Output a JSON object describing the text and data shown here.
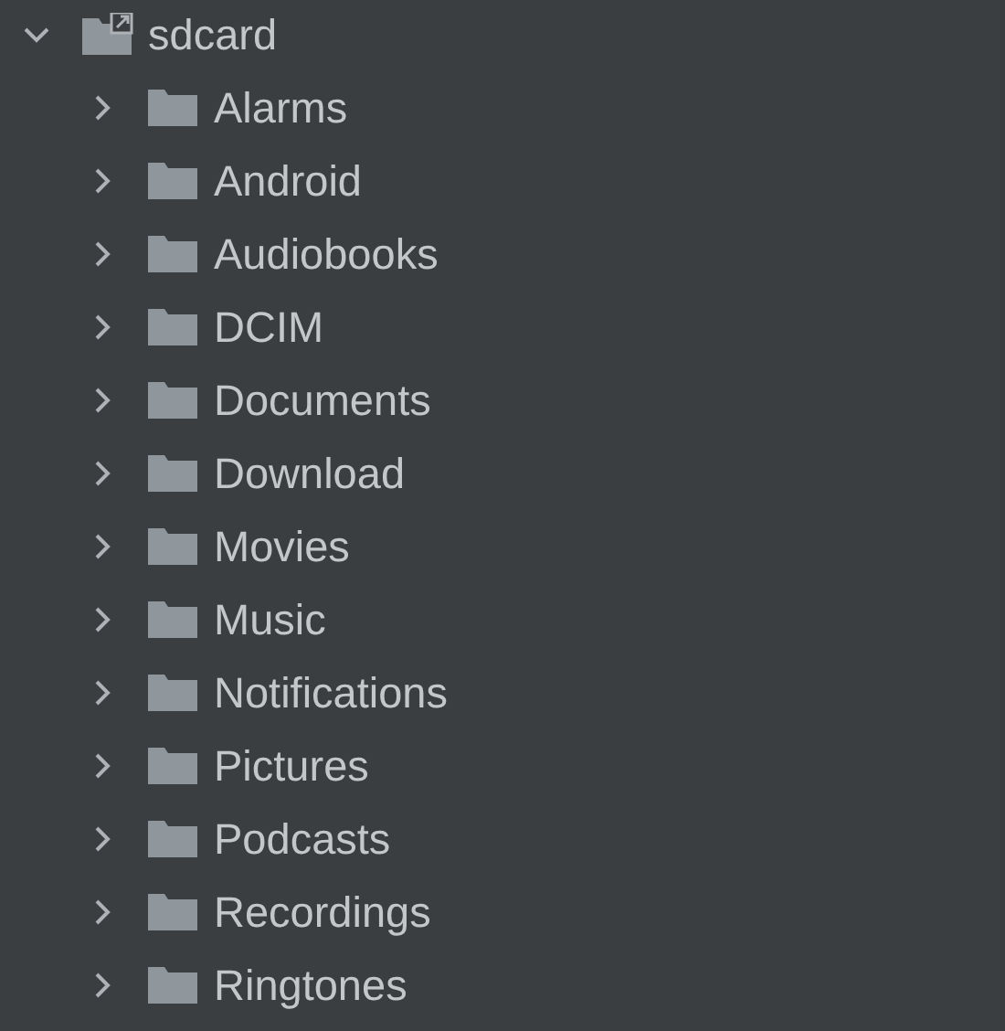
{
  "tree": {
    "label": "sdcard",
    "kind": "link",
    "expanded": true,
    "children": [
      {
        "label": "Alarms",
        "kind": "folder",
        "expanded": false
      },
      {
        "label": "Android",
        "kind": "folder",
        "expanded": false
      },
      {
        "label": "Audiobooks",
        "kind": "folder",
        "expanded": false
      },
      {
        "label": "DCIM",
        "kind": "folder",
        "expanded": false
      },
      {
        "label": "Documents",
        "kind": "folder",
        "expanded": false
      },
      {
        "label": "Download",
        "kind": "folder",
        "expanded": false
      },
      {
        "label": "Movies",
        "kind": "folder",
        "expanded": false
      },
      {
        "label": "Music",
        "kind": "folder",
        "expanded": false
      },
      {
        "label": "Notifications",
        "kind": "folder",
        "expanded": false
      },
      {
        "label": "Pictures",
        "kind": "folder",
        "expanded": false
      },
      {
        "label": "Podcasts",
        "kind": "folder",
        "expanded": false
      },
      {
        "label": "Recordings",
        "kind": "folder",
        "expanded": false
      },
      {
        "label": "Ringtones",
        "kind": "folder",
        "expanded": false
      }
    ]
  }
}
